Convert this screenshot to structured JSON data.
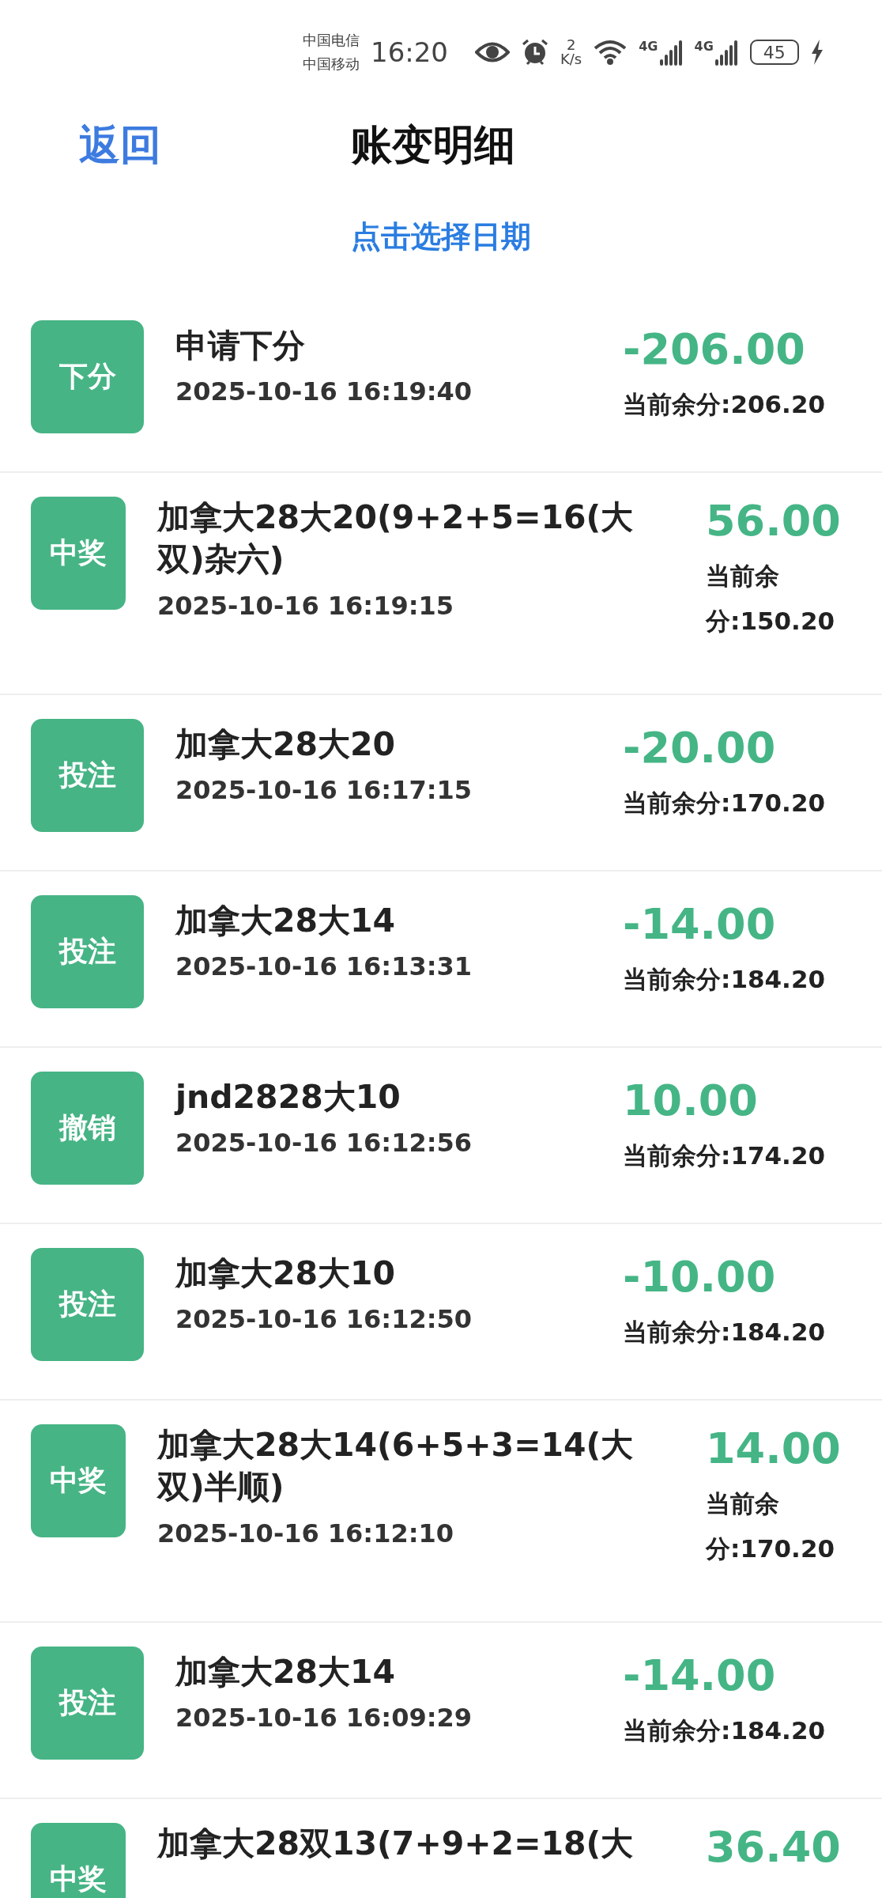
{
  "status_bar": {
    "carriers": [
      "中国电信",
      "中国移动"
    ],
    "time": "16:20",
    "speed_value": "2",
    "speed_unit": "K/s",
    "network_labels": [
      "4G",
      "4G"
    ],
    "battery": "45"
  },
  "header": {
    "back": "返回",
    "title": "账变明细"
  },
  "date_picker": "点击选择日期",
  "records": [
    {
      "kind": "short",
      "badge": "下分",
      "title": "申请下分",
      "time": "2025-10-16 16:19:40",
      "amount": "-206.00",
      "balance": "当前余分:206.20"
    },
    {
      "kind": "long",
      "badge": "中奖",
      "title": "加拿大28大20(9+2+5=16(大双)杂六)",
      "time": "2025-10-16 16:19:15",
      "amount": "56.00",
      "balance": "当前余分:150.20"
    },
    {
      "kind": "short",
      "badge": "投注",
      "title": "加拿大28大20",
      "time": "2025-10-16 16:17:15",
      "amount": "-20.00",
      "balance": "当前余分:170.20"
    },
    {
      "kind": "short",
      "badge": "投注",
      "title": "加拿大28大14",
      "time": "2025-10-16 16:13:31",
      "amount": "-14.00",
      "balance": "当前余分:184.20"
    },
    {
      "kind": "short",
      "badge": "撤销",
      "title": "jnd2828大10",
      "time": "2025-10-16 16:12:56",
      "amount": "10.00",
      "balance": "当前余分:174.20"
    },
    {
      "kind": "short",
      "badge": "投注",
      "title": "加拿大28大10",
      "time": "2025-10-16 16:12:50",
      "amount": "-10.00",
      "balance": "当前余分:184.20"
    },
    {
      "kind": "long",
      "badge": "中奖",
      "title": "加拿大28大14(6+5+3=14(大双)半顺)",
      "time": "2025-10-16 16:12:10",
      "amount": "14.00",
      "balance": "当前余分:170.20"
    },
    {
      "kind": "short",
      "badge": "投注",
      "title": "加拿大28大14",
      "time": "2025-10-16 16:09:29",
      "amount": "-14.00",
      "balance": "当前余分:184.20"
    },
    {
      "kind": "cut",
      "badge": "中奖",
      "title": "加拿大28双13(7+9+2=18(大",
      "amount": "36.40"
    }
  ]
}
